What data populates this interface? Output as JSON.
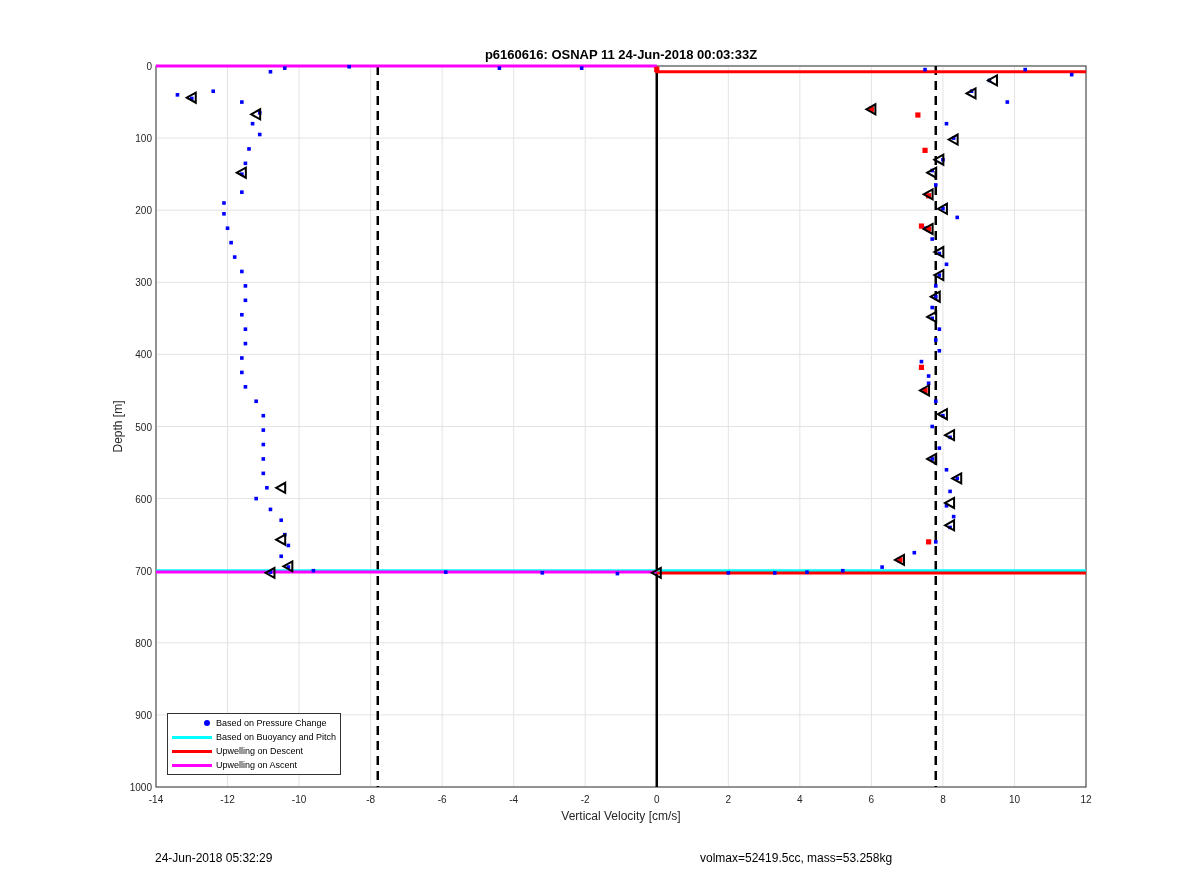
{
  "chart_data": {
    "type": "scatter",
    "title": "p6160616: OSNAP 11 24-Jun-2018 00:03:33Z",
    "xlabel": "Vertical Velocity [cm/s]",
    "ylabel": "Depth [m]",
    "xlim": [
      -14,
      12
    ],
    "ylim": [
      1000,
      0
    ],
    "xticks": [
      -14,
      -12,
      -10,
      -8,
      -6,
      -4,
      -2,
      0,
      2,
      4,
      6,
      8,
      10,
      12
    ],
    "yticks": [
      0,
      100,
      200,
      300,
      400,
      500,
      600,
      700,
      800,
      900,
      1000
    ],
    "grid": true,
    "legend": true,
    "series": [
      {
        "name": "Based on Pressure Change",
        "type": "scatter",
        "color": "#0000ff",
        "x": [
          7.5,
          10.3,
          11.6,
          9.3,
          8.8,
          9.8,
          8.1,
          8.3,
          8,
          7.7,
          7.8,
          8,
          8.4,
          7.5,
          7.7,
          7.9,
          8.1,
          7.9,
          7.8,
          7.8,
          7.7,
          7.7,
          7.9,
          7.8,
          7.9,
          7.4,
          7.6,
          7.6,
          7.8,
          8,
          7.7,
          8.2,
          7.9,
          7.7,
          8.1,
          8.4,
          8.2,
          8.1,
          8.3,
          8.2,
          7.8,
          7.2,
          6.3,
          5.2,
          4.2,
          3.3,
          2,
          -10.8,
          -9.6,
          -10.3,
          -10.5,
          -10.3,
          -10.4,
          -10.5,
          -10.8,
          -11.2,
          -10.9,
          -11,
          -11,
          -11,
          -11,
          -11,
          -11.2,
          -11.5,
          -11.6,
          -11.6,
          -11.5,
          -11.5,
          -11.6,
          -11.5,
          -11.5,
          -11.6,
          -11.8,
          -11.9,
          -12,
          -12.1,
          -12.1,
          -11.6,
          -11.6,
          -11.5,
          -11.4,
          -11.1,
          -11.3,
          -11.1,
          -11.6,
          -12.4,
          -13,
          -13.4,
          -10.8,
          -10.4,
          -8.6,
          -4.4,
          -2.1,
          -5.9,
          -3.2,
          -1.1
        ],
        "values": [
          5,
          5,
          12,
          20,
          35,
          50,
          80,
          100,
          130,
          145,
          165,
          198,
          210,
          225,
          240,
          260,
          275,
          290,
          305,
          320,
          335,
          350,
          365,
          380,
          395,
          410,
          430,
          440,
          465,
          485,
          500,
          515,
          530,
          545,
          560,
          572,
          590,
          610,
          625,
          640,
          660,
          675,
          695,
          700,
          702,
          703,
          703,
          702,
          700,
          695,
          680,
          665,
          650,
          630,
          615,
          600,
          585,
          565,
          545,
          525,
          505,
          485,
          465,
          445,
          425,
          405,
          385,
          365,
          345,
          325,
          305,
          285,
          265,
          245,
          225,
          205,
          190,
          175,
          150,
          135,
          115,
          95,
          80,
          65,
          50,
          35,
          45,
          40,
          8,
          3,
          1,
          3,
          3,
          702,
          703,
          704
        ]
      },
      {
        "name": "Based on Buoyancy and Pitch",
        "type": "line",
        "color": "#00ffff",
        "x": [
          -14,
          12
        ],
        "values": [
          700,
          700
        ]
      },
      {
        "name": "Upwelling on Descent",
        "type": "line",
        "color": "#ff0000",
        "x": [
          0,
          0,
          12
        ],
        "values": [
          0,
          8,
          8
        ]
      },
      {
        "name": "Upwelling on Ascent",
        "type": "line",
        "color": "#ff00ff",
        "x": [
          -14,
          0
        ],
        "values": [
          0,
          0
        ]
      },
      {
        "type": "line",
        "color": "#ff0000",
        "x": [
          0,
          12
        ],
        "values": [
          703,
          703
        ]
      },
      {
        "type": "line",
        "color": "#ff00ff",
        "x": [
          -14,
          0
        ],
        "values": [
          702,
          702
        ]
      },
      {
        "type": "scatter",
        "color": "#ff0000",
        "x": [
          6,
          7.3,
          7.5,
          7.6,
          7.4,
          7.6,
          7.4,
          7.5,
          7.6,
          6.8,
          0
        ],
        "values": [
          60,
          68,
          117,
          180,
          222,
          226,
          418,
          450,
          660,
          685,
          5
        ]
      },
      {
        "type": "scatter",
        "color": "#000000",
        "x": [
          9.4,
          8.8,
          6,
          8.3,
          7.9,
          7.7,
          7.6,
          8,
          7.6,
          7.9,
          7.9,
          7.8,
          7.7,
          7.5,
          8,
          8.2,
          7.7,
          8.4,
          8.2,
          8.2,
          6.8,
          0,
          -13,
          -11.2,
          -11.6,
          -10.5,
          -10.5,
          -10.3,
          -10.8
        ],
        "values": [
          20,
          38,
          60,
          102,
          130,
          148,
          178,
          198,
          226,
          258,
          290,
          320,
          348,
          450,
          483,
          512,
          545,
          572,
          606,
          637,
          685,
          703,
          44,
          67,
          148,
          585,
          657,
          694,
          703
        ]
      }
    ],
    "ref_lines": [
      {
        "axis": "x",
        "value": -7.8
      },
      {
        "axis": "x",
        "value": 7.8
      },
      {
        "axis": "x",
        "value": 0
      }
    ]
  },
  "footer": {
    "timestamp": "24-Jun-2018 05:32:29",
    "summary": "volmax=52419.5cc, mass=53.258kg"
  }
}
